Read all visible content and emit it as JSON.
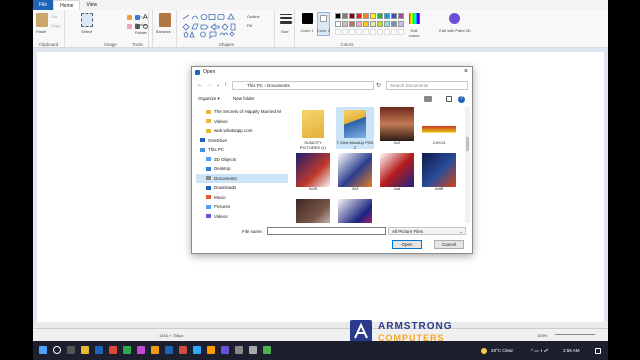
{
  "ribbon": {
    "tabs": [
      "File",
      "Home",
      "View"
    ],
    "groups": {
      "clipboard": {
        "label": "Clipboard",
        "paste": "Paste",
        "cut": "Cut",
        "copy": "Copy"
      },
      "image": {
        "label": "Image",
        "select": "Select",
        "crop": "Crop",
        "resize": "Resize",
        "rotate": "Rotate"
      },
      "tools": {
        "label": "Tools"
      },
      "brushes": {
        "label": "Brushes"
      },
      "shapes": {
        "label": "Shapes",
        "outline": "Outline",
        "fill": "Fill"
      },
      "size": {
        "label": "Size"
      },
      "colors": {
        "label": "Colors",
        "color1": "Color 1",
        "color2": "Color 2",
        "edit": "Edit colors",
        "paint3d": "Edit with Paint 3D"
      }
    },
    "palette": [
      "#000000",
      "#7f7f7f",
      "#880015",
      "#ed1c24",
      "#ff7f27",
      "#fff200",
      "#22b14c",
      "#00a2e8",
      "#3f48cc",
      "#a349a4",
      "#ffffff",
      "#c3c3c3",
      "#b97a57",
      "#ffaec9",
      "#ffc90e",
      "#efe4b0",
      "#b5e61d",
      "#99d9ea",
      "#7092be",
      "#c8bfe7"
    ]
  },
  "status": {
    "dimensions": "1434 × 755px",
    "zoom": "100%"
  },
  "dialog": {
    "title": "Open",
    "breadcrumb": [
      "This PC",
      "Documents"
    ],
    "search_placeholder": "Search Documents",
    "organize": "Organize ▾",
    "new_folder": "New folder",
    "nav_items": [
      {
        "label": "The Secrets of Happily Married M",
        "type": "folder"
      },
      {
        "label": "Videos",
        "type": "folder"
      },
      {
        "label": "web.whatsapp.com",
        "type": "folder"
      },
      {
        "label": "OneDrive",
        "type": "cloud"
      },
      {
        "label": "This PC",
        "type": "pc"
      },
      {
        "label": "3D Objects",
        "type": "cube"
      },
      {
        "label": "Desktop",
        "type": "desktop"
      },
      {
        "label": "Documents",
        "type": "docs"
      },
      {
        "label": "Downloads",
        "type": "download"
      },
      {
        "label": "Music",
        "type": "music"
      },
      {
        "label": "Pictures",
        "type": "pictures"
      },
      {
        "label": "Videos",
        "type": "video"
      }
    ],
    "files": [
      {
        "label": "SUNCITY PICTURES (1)",
        "kind": "folder"
      },
      {
        "label": "T-Shirt MockUp PSD 2",
        "kind": "folder-blue"
      },
      {
        "label": "2x2",
        "kind": "photo"
      },
      {
        "label": "3.5X13",
        "kind": "banner"
      },
      {
        "label": "3x2ft",
        "kind": "flyer"
      },
      {
        "label": "3x3",
        "kind": "flyer2"
      },
      {
        "label": "4x6",
        "kind": "flyer3"
      },
      {
        "label": "4x9ft",
        "kind": "flyer4"
      },
      {
        "label": "",
        "kind": "flyer5"
      },
      {
        "label": "",
        "kind": "flyer6"
      }
    ],
    "file_name_label": "File name:",
    "file_name_value": "",
    "file_type": "All Picture Files",
    "open": "Open",
    "cancel": "Cancel"
  },
  "watermark": {
    "line1": "ARMSTRONG",
    "line2": "COMPUTERS"
  },
  "taskbar": {
    "weather": "28°C  Clear",
    "time": "2:55 AM"
  }
}
